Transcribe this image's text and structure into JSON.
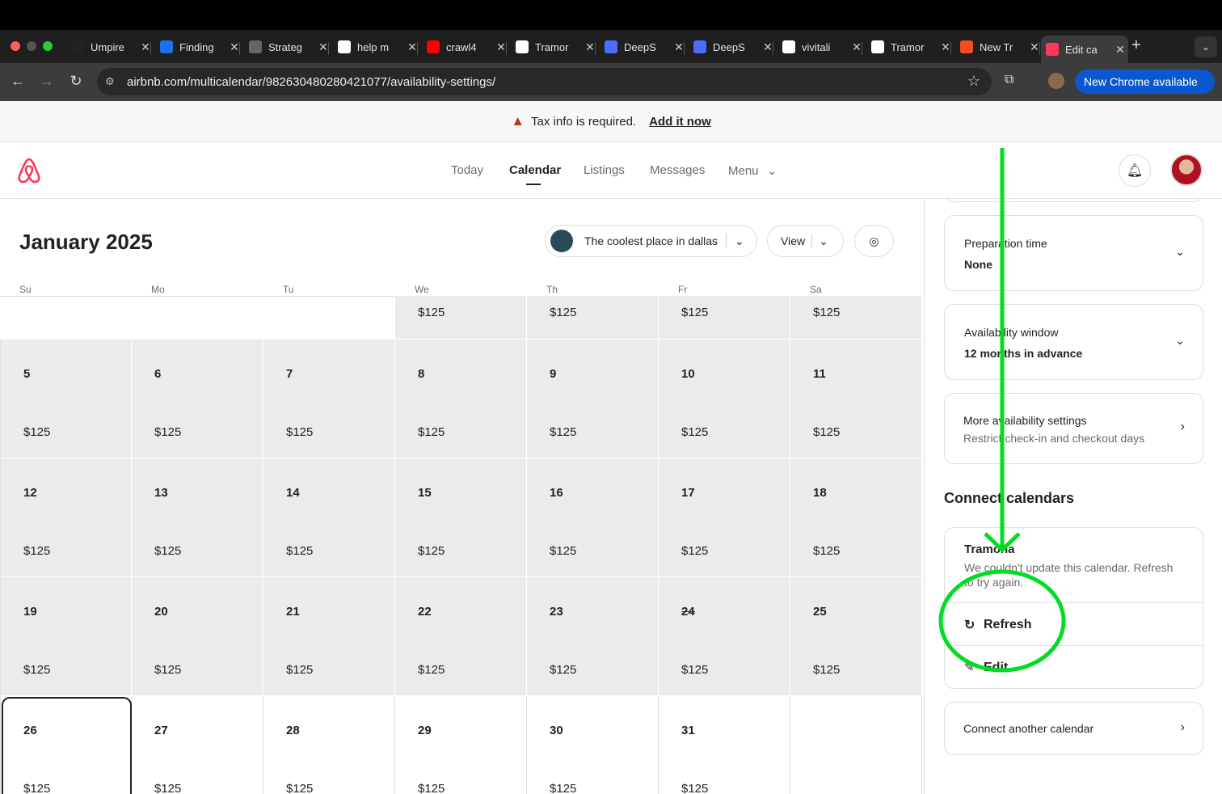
{
  "browser": {
    "tabs": [
      {
        "title": "Umpire",
        "fav": "#222"
      },
      {
        "title": "Finding",
        "fav": "#1a73e8"
      },
      {
        "title": "Strateg",
        "fav": "#666"
      },
      {
        "title": "help m",
        "fav": "#fff"
      },
      {
        "title": "crawl4",
        "fav": "#ff0000"
      },
      {
        "title": "Tramor",
        "fav": "#fff"
      },
      {
        "title": "DeepS",
        "fav": "#4d6bfe"
      },
      {
        "title": "DeepS",
        "fav": "#4d6bfe"
      },
      {
        "title": "vivitali",
        "fav": "#fff"
      },
      {
        "title": "Tramor",
        "fav": "#fff"
      },
      {
        "title": "New Tr",
        "fav": "#f24e1e"
      }
    ],
    "active_tab": {
      "title": "Edit ca",
      "fav": "#ff385c"
    },
    "url": "airbnb.com/multicalendar/982630480280421077/availability-settings/",
    "new_chrome": "New Chrome available"
  },
  "banner": {
    "text": "Tax info is required.",
    "link": "Add it now"
  },
  "nav": {
    "today": "Today",
    "calendar": "Calendar",
    "listings": "Listings",
    "messages": "Messages",
    "menu": "Menu"
  },
  "calendar": {
    "month": "January 2025",
    "listing": "The coolest place in dallas",
    "view": "View",
    "dow": [
      "Su",
      "Mo",
      "Tu",
      "We",
      "Th",
      "Fr",
      "Sa"
    ],
    "week1_prices": [
      "$125",
      "$125",
      "$125",
      "$125"
    ],
    "weeks": [
      {
        "days": [
          "5",
          "6",
          "7",
          "8",
          "9",
          "10",
          "11"
        ],
        "prices": [
          "$125",
          "$125",
          "$125",
          "$125",
          "$125",
          "$125",
          "$125"
        ]
      },
      {
        "days": [
          "12",
          "13",
          "14",
          "15",
          "16",
          "17",
          "18"
        ],
        "prices": [
          "$125",
          "$125",
          "$125",
          "$125",
          "$125",
          "$125",
          "$125"
        ]
      },
      {
        "days": [
          "19",
          "20",
          "21",
          "22",
          "23",
          "24",
          "25"
        ],
        "prices": [
          "$125",
          "$125",
          "$125",
          "$125",
          "$125",
          "$125",
          "$125"
        ]
      },
      {
        "days": [
          "26",
          "27",
          "28",
          "29",
          "30",
          "31"
        ],
        "prices": [
          "$125",
          "$125",
          "$125",
          "$125",
          "$125",
          "$125"
        ]
      }
    ]
  },
  "side": {
    "prep": {
      "label": "Preparation time",
      "value": "None"
    },
    "window": {
      "label": "Availability window",
      "value": "12 months in advance"
    },
    "more": {
      "label": "More availability settings",
      "sub": "Restrict check-in and checkout days"
    },
    "connect_title": "Connect calendars",
    "tramona": {
      "name": "Tramona",
      "msg1": "We couldn't update this calendar. Refresh",
      "msg2": "to try again.",
      "refresh": "Refresh",
      "edit": "Edit"
    },
    "another": "Connect another calendar"
  },
  "annotation": {
    "color": "#00dd22"
  }
}
